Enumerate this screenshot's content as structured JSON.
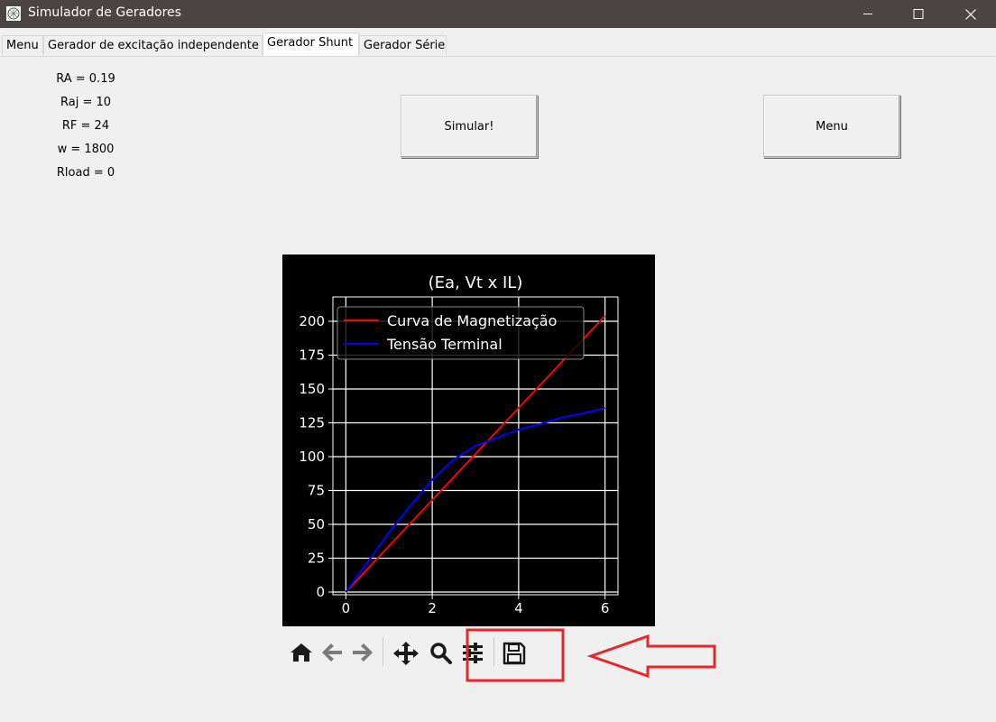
{
  "window": {
    "title": "Simulador de Geradores",
    "controls": [
      "minimize",
      "maximize",
      "close"
    ]
  },
  "tabs": [
    {
      "label": "Menu",
      "active": false
    },
    {
      "label": "Gerador de excitação independente",
      "active": false
    },
    {
      "label": "Gerador Shunt",
      "active": true
    },
    {
      "label": "Gerador Série",
      "active": false
    }
  ],
  "params": [
    "RA = 0.19",
    "Raj = 10",
    "RF = 24",
    "w = 1800",
    "Rload = 0"
  ],
  "buttons": {
    "simulate": "Simular!",
    "menu": "Menu"
  },
  "chart_data": {
    "type": "line",
    "title": "(Ea, Vt x IL)",
    "xlabel": "",
    "ylabel": "",
    "xlim": [
      -0.3,
      6.3
    ],
    "ylim": [
      -2,
      218
    ],
    "xticks": [
      0,
      2,
      4,
      6
    ],
    "yticks": [
      0,
      25,
      50,
      75,
      100,
      125,
      150,
      175,
      200
    ],
    "grid": true,
    "legend": "upper-left",
    "background": "#000000",
    "series": [
      {
        "name": "Curva de  Magnetização",
        "color": "#ff0000",
        "x": [
          0,
          1,
          2,
          3,
          4,
          5,
          6
        ],
        "y": [
          0,
          34,
          68,
          102,
          136,
          170,
          204
        ]
      },
      {
        "name": "Tensão Terminal",
        "color": "#0000ff",
        "x": [
          0,
          0.5,
          1,
          1.5,
          2,
          2.5,
          3,
          3.5,
          4,
          4.5,
          5,
          5.5,
          6
        ],
        "y": [
          0,
          22,
          44,
          64,
          83,
          98,
          108,
          114,
          120,
          124,
          129,
          132,
          136
        ]
      }
    ]
  },
  "toolbar": {
    "icons": [
      "home-icon",
      "back-arrow-icon",
      "forward-arrow-icon",
      "pan-icon",
      "zoom-icon",
      "configure-subplots-icon",
      "save-icon"
    ]
  },
  "annotation": {
    "color": "#e8262b",
    "meaning": "red box and arrow highlighting the save icon"
  }
}
